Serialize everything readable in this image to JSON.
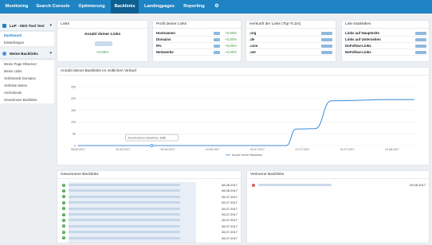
{
  "colors": {
    "brand": "#1e84c4",
    "brand_active": "#0e5f91",
    "positive": "#3c9a3c",
    "negative": "#d9534f",
    "line": "#3b8bd8"
  },
  "nav": {
    "items": [
      {
        "label": "Monitoring"
      },
      {
        "label": "Search Console"
      },
      {
        "label": "Optimierung"
      },
      {
        "label": "Backlinks",
        "active": true
      },
      {
        "label": "Landingpages"
      },
      {
        "label": "Reporting"
      }
    ],
    "settings_icon": "gear-icon"
  },
  "sidebar": {
    "project": {
      "label": "LuP - SEO-Tool Test",
      "icon": "grid-icon"
    },
    "project_links": [
      {
        "label": "Dashboard",
        "active": true
      },
      {
        "label": "Einstellungen"
      }
    ],
    "section": {
      "label": "Meine Backlinks",
      "icon": "link-icon"
    },
    "section_links": [
      {
        "label": "Meine Page-Observer"
      },
      {
        "label": "Meine Links"
      },
      {
        "label": "Verlinkende Domains"
      },
      {
        "label": "Verlinkte Seiten"
      },
      {
        "label": "Anchortexte"
      },
      {
        "label": "Gewonnene Backlinks"
      }
    ]
  },
  "links_panel": {
    "title": "Links",
    "count_label": "Anzahl deiner Links",
    "change": "+0,00%"
  },
  "profile_panel": {
    "title": "Profil deiner Links",
    "rows": [
      {
        "label": "Hostnamen",
        "change": "+0,00%"
      },
      {
        "label": "Domains",
        "change": "+0,00%"
      },
      {
        "label": "IPs",
        "change": "+0,00%"
      },
      {
        "label": "Netzwerke",
        "change": "+0,00%"
      }
    ]
  },
  "tld_panel": {
    "title": "Herkunft der Links (Top-TLDs)",
    "rows": [
      {
        "label": ".org"
      },
      {
        "label": ".de"
      },
      {
        "label": ".com"
      },
      {
        "label": ".net"
      }
    ]
  },
  "stats_panel": {
    "title": "Link-Statistiken",
    "rows": [
      {
        "label": "Links auf Hauptseite"
      },
      {
        "label": "Links auf Unterseiten"
      },
      {
        "label": "DoFollow-Links"
      },
      {
        "label": "NoFollow-Links"
      }
    ]
  },
  "chart_panel": {
    "title": "Anzahl deiner Backlinks im zeitlichen Verlauf",
    "tooltip_label": "Anzahl deiner Backlinks:",
    "tooltip_value": "0,00"
  },
  "chart_data": {
    "type": "line",
    "x": [
      "08.05.2017",
      "22.05.2017",
      "05.06.2017",
      "19.06.2017",
      "03.07.2017",
      "17.07.2017",
      "31.07.2017",
      "14.08.2017"
    ],
    "ylim": [
      0,
      250
    ],
    "yticks": [
      0,
      50,
      100,
      150,
      200,
      250
    ],
    "series": [
      {
        "name": "Anzahl deiner Backlinks",
        "points": [
          {
            "x": "08.05.2017",
            "y": 0
          },
          {
            "x": "22.05.2017",
            "y": 0
          },
          {
            "x": "05.06.2017",
            "y": 0
          },
          {
            "x": "19.06.2017",
            "y": 0
          },
          {
            "x": "03.07.2017",
            "y": 0
          },
          {
            "x": "12.07.2017",
            "y": 0
          },
          {
            "x": "15.07.2017",
            "y": 70
          },
          {
            "x": "21.07.2017",
            "y": 72
          },
          {
            "x": "26.07.2017",
            "y": 190
          },
          {
            "x": "14.08.2017",
            "y": 195
          },
          {
            "x": "21.08.2017",
            "y": 195
          }
        ]
      }
    ],
    "legend": "bottom-center",
    "grid": true
  },
  "won_panel": {
    "title": "Gewonnene Backlinks",
    "dates": [
      "08.08.2017",
      "08.08.2017",
      "26.07.2017",
      "26.07.2017",
      "26.07.2017",
      "26.07.2017",
      "26.07.2017",
      "26.07.2017",
      "26.07.2017",
      "26.07.2017"
    ]
  },
  "lost_panel": {
    "title": "Verlorene Backlinks",
    "dates": [
      "09.08.2017"
    ]
  }
}
